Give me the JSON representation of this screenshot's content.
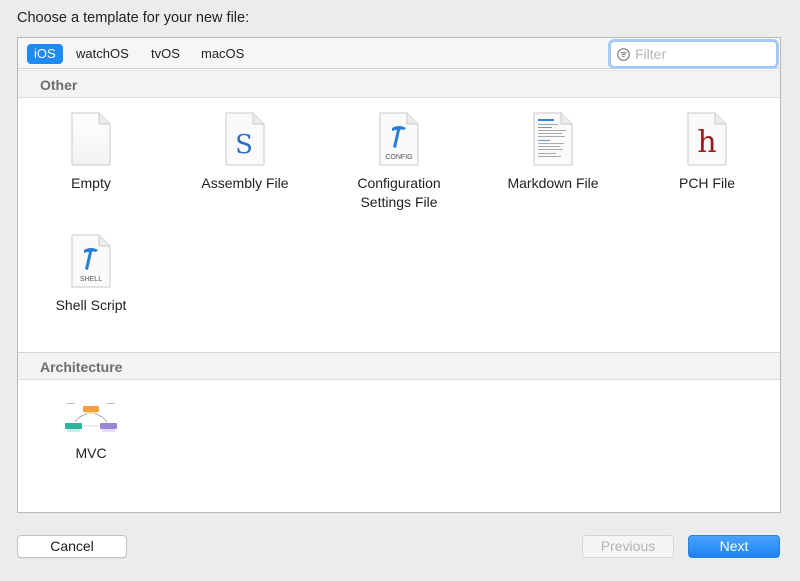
{
  "dialog": {
    "title": "Choose a template for your new file:"
  },
  "tabs": [
    {
      "label": "iOS",
      "selected": true
    },
    {
      "label": "watchOS",
      "selected": false
    },
    {
      "label": "tvOS",
      "selected": false
    },
    {
      "label": "macOS",
      "selected": false
    }
  ],
  "filter": {
    "placeholder": "Filter",
    "value": ""
  },
  "sections": {
    "other": {
      "title": "Other",
      "items": [
        {
          "label": "Empty",
          "icon": "empty-file-icon"
        },
        {
          "label": "Assembly File",
          "icon": "assembly-file-icon",
          "glyph": "S"
        },
        {
          "label": "Configuration\nSettings File",
          "icon": "config-file-icon",
          "badge": "CONFIG"
        },
        {
          "label": "Markdown File",
          "icon": "markdown-file-icon"
        },
        {
          "label": "PCH File",
          "icon": "pch-file-icon",
          "glyph": "h"
        },
        {
          "label": "Shell Script",
          "icon": "shell-script-icon",
          "badge": "SHELL"
        }
      ]
    },
    "architecture": {
      "title": "Architecture",
      "items": [
        {
          "label": "MVC",
          "icon": "mvc-icon"
        }
      ]
    }
  },
  "buttons": {
    "cancel": "Cancel",
    "previous": "Previous",
    "next": "Next"
  },
  "colors": {
    "accent": "#1c8bf5",
    "pch_glyph": "#9b1b1b",
    "assembly_glyph": "#2a6fc4"
  }
}
